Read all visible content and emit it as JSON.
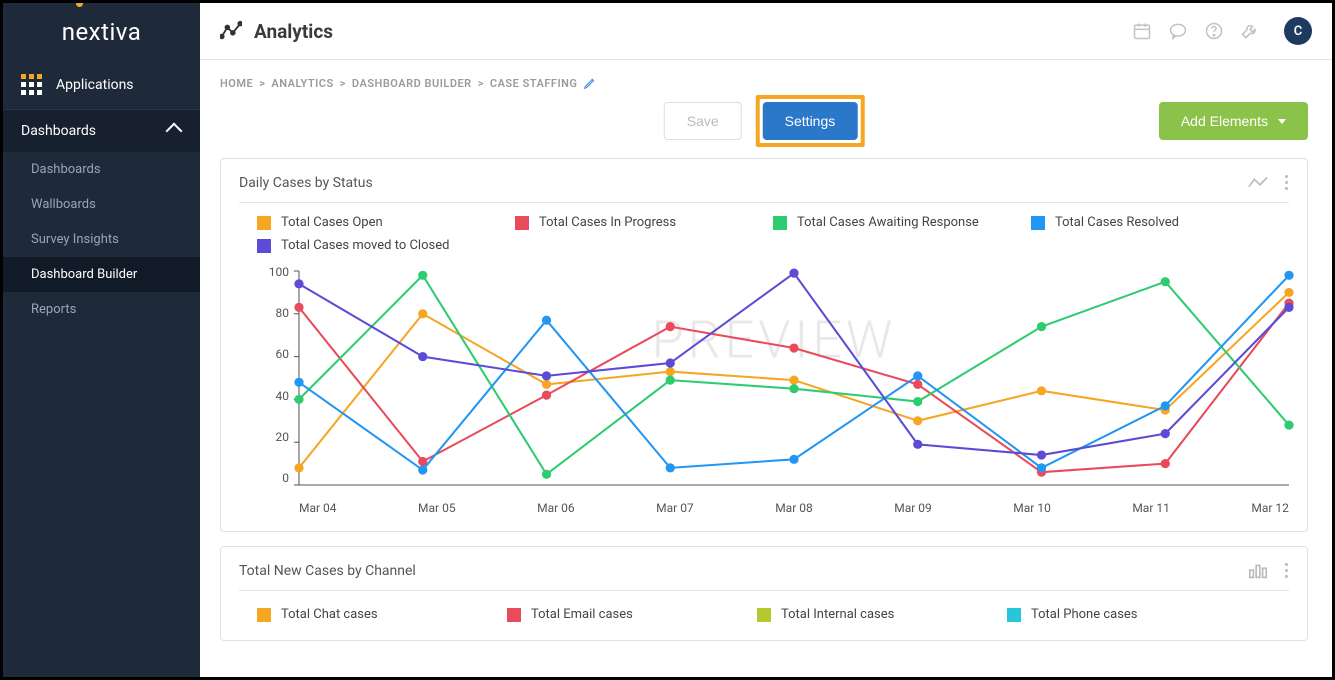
{
  "brand": "nextiva",
  "applications_label": "Applications",
  "sidebar": {
    "section": "Dashboards",
    "items": [
      {
        "label": "Dashboards",
        "active": false
      },
      {
        "label": "Wallboards",
        "active": false
      },
      {
        "label": "Survey Insights",
        "active": false
      },
      {
        "label": "Dashboard Builder",
        "active": true
      }
    ],
    "reports": "Reports"
  },
  "header": {
    "title": "Analytics",
    "avatar_initial": "C"
  },
  "breadcrumb": {
    "home": "HOME",
    "analytics": "ANALYTICS",
    "builder": "DASHBOARD BUILDER",
    "current": "CASE STAFFING",
    "sep": ">"
  },
  "actions": {
    "save": "Save",
    "settings": "Settings",
    "add": "Add Elements"
  },
  "watermark": "PREVIEW",
  "panel1": {
    "title": "Daily Cases by Status",
    "legend": [
      {
        "label": "Total Cases Open",
        "color": "#f5a623"
      },
      {
        "label": "Total Cases In Progress",
        "color": "#e94b5b"
      },
      {
        "label": "Total Cases Awaiting Response",
        "color": "#2ecc71"
      },
      {
        "label": "Total Cases Resolved",
        "color": "#2196f3"
      },
      {
        "label": "Total Cases moved to Closed",
        "color": "#5c4bd4"
      }
    ]
  },
  "panel2": {
    "title": "Total New Cases by Channel",
    "legend": [
      {
        "label": "Total Chat cases",
        "color": "#f5a623"
      },
      {
        "label": "Total Email cases",
        "color": "#e94b5b"
      },
      {
        "label": "Total Internal cases",
        "color": "#b5c92f"
      },
      {
        "label": "Total Phone cases",
        "color": "#29c5d8"
      }
    ]
  },
  "chart_data": {
    "type": "line",
    "categories": [
      "Mar 04",
      "Mar 05",
      "Mar 06",
      "Mar 07",
      "Mar 08",
      "Mar 09",
      "Mar 10",
      "Mar 11",
      "Mar 12"
    ],
    "ylim": [
      0,
      100
    ],
    "yticks": [
      0,
      20,
      40,
      60,
      80,
      100
    ],
    "series": [
      {
        "name": "Total Cases Open",
        "color": "#f5a623",
        "values": [
          8,
          80,
          47,
          53,
          49,
          30,
          44,
          35,
          90
        ]
      },
      {
        "name": "Total Cases In Progress",
        "color": "#e94b5b",
        "values": [
          83,
          11,
          42,
          74,
          64,
          47,
          6,
          10,
          85
        ]
      },
      {
        "name": "Total Cases Awaiting Response",
        "color": "#2ecc71",
        "values": [
          40,
          98,
          5,
          49,
          45,
          39,
          74,
          95,
          28
        ]
      },
      {
        "name": "Total Cases Resolved",
        "color": "#2196f3",
        "values": [
          48,
          7,
          77,
          8,
          12,
          51,
          8,
          37,
          98
        ]
      },
      {
        "name": "Total Cases moved to Closed",
        "color": "#5c4bd4",
        "values": [
          94,
          60,
          51,
          57,
          99,
          19,
          14,
          24,
          83
        ]
      }
    ]
  }
}
